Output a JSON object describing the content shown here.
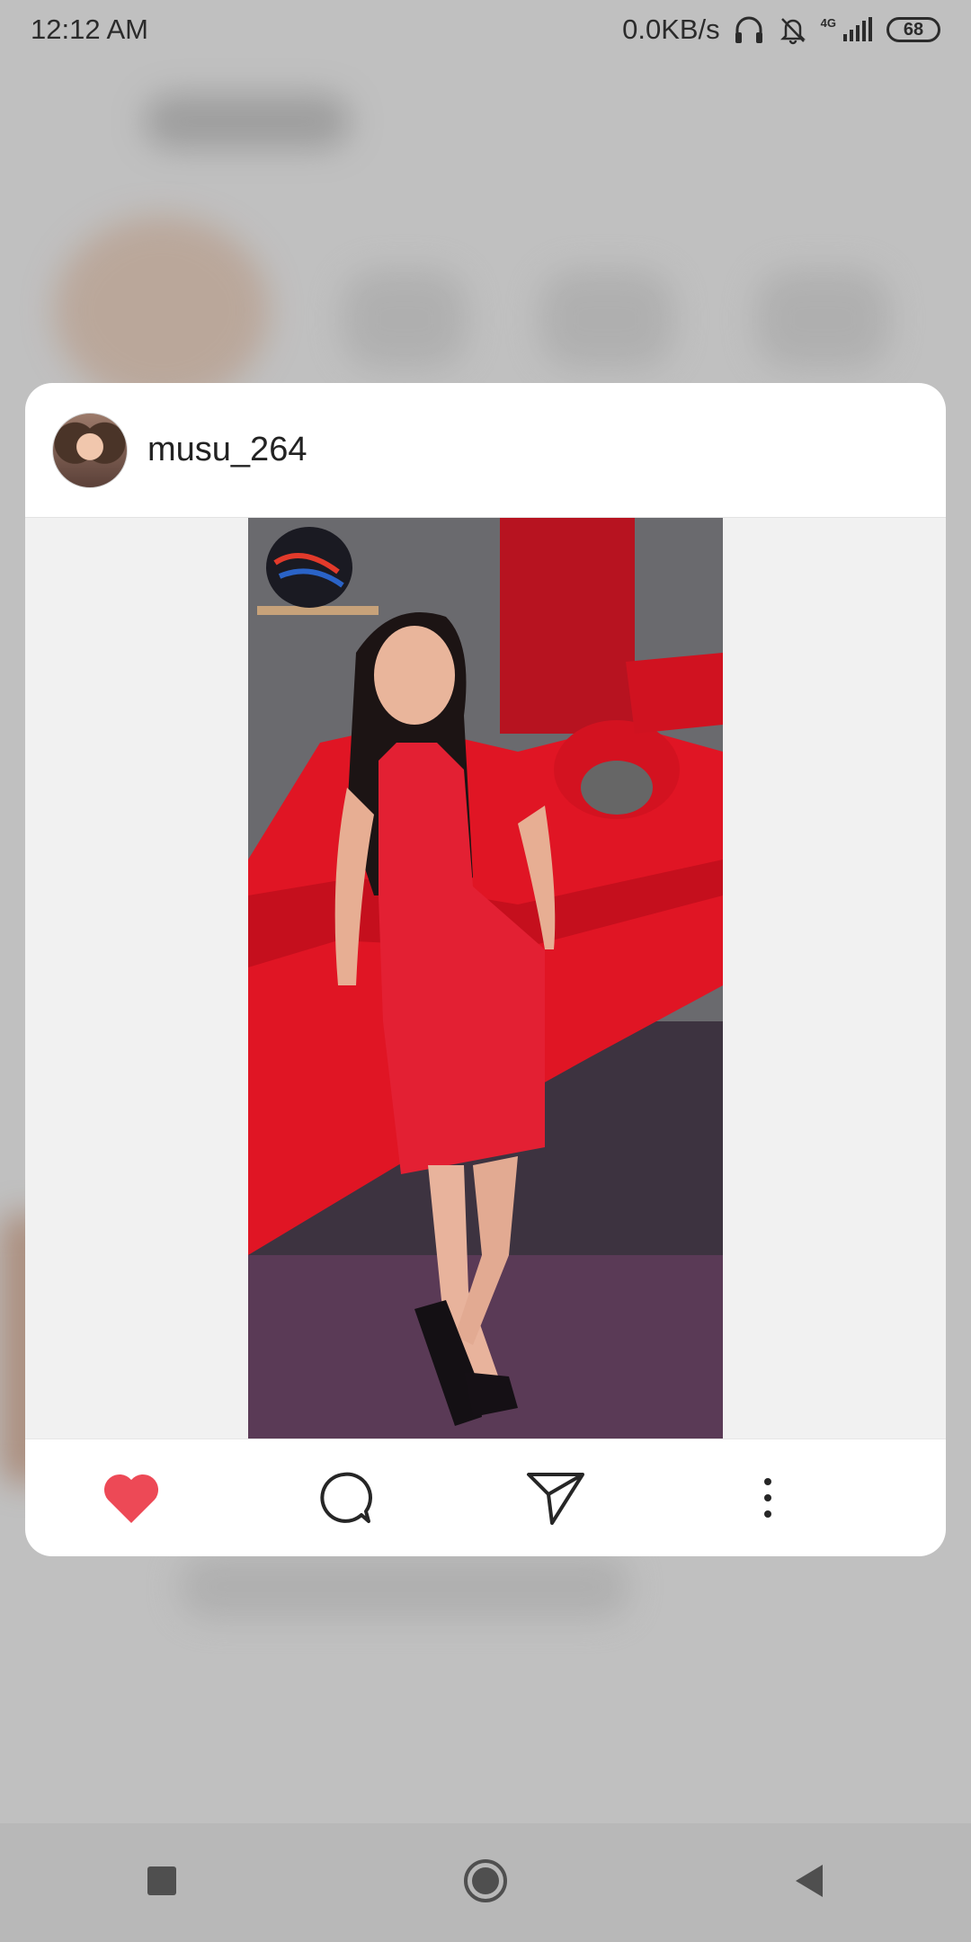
{
  "status_bar": {
    "time": "12:12 AM",
    "net_speed": "0.0KB/s",
    "network_type": "4G",
    "battery": "68"
  },
  "post": {
    "username": "musu_264",
    "liked": true,
    "like_color": "#ed4956"
  },
  "icons": {
    "headphones": "headphones-icon",
    "mute": "bell-off-icon",
    "signal": "signal-icon",
    "battery": "battery-icon",
    "like": "heart-icon",
    "comment": "comment-icon",
    "share": "send-icon",
    "more": "more-vertical-icon",
    "recents": "square-icon",
    "home": "circle-icon",
    "back": "triangle-back-icon"
  }
}
